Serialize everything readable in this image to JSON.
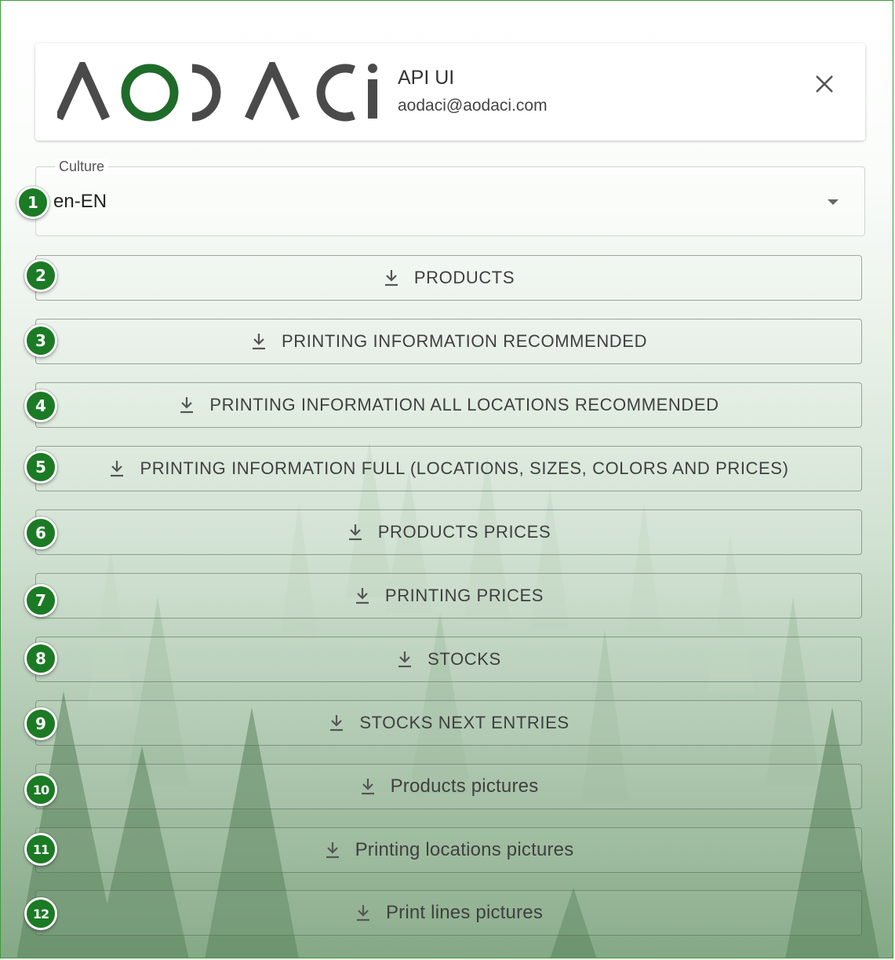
{
  "header": {
    "logo_text": "AODACi",
    "app_name": "API UI",
    "email": "aodaci@aodaci.com",
    "close_icon": "close-icon"
  },
  "culture_select": {
    "label": "Culture",
    "value": "en-EN"
  },
  "download_icon": "download-icon",
  "buttons": [
    {
      "badge": "1",
      "label": ""
    },
    {
      "badge": "2",
      "label": "PRODUCTS"
    },
    {
      "badge": "3",
      "label": "PRINTING INFORMATION RECOMMENDED"
    },
    {
      "badge": "4",
      "label": "PRINTING INFORMATION ALL LOCATIONS RECOMMENDED"
    },
    {
      "badge": "5",
      "label": "PRINTING INFORMATION FULL (LOCATIONS, SIZES, COLORS AND PRICES)"
    },
    {
      "badge": "6",
      "label": "PRODUCTS PRICES"
    },
    {
      "badge": "7",
      "label": "PRINTING PRICES"
    },
    {
      "badge": "8",
      "label": "STOCKS"
    },
    {
      "badge": "9",
      "label": "STOCKS NEXT ENTRIES"
    },
    {
      "badge": "10",
      "label": "Products pictures"
    },
    {
      "badge": "11",
      "label": "Printing locations pictures"
    },
    {
      "badge": "12",
      "label": "Print lines pictures"
    }
  ],
  "colors": {
    "badge_green": "#1b7a24",
    "logo_gray": "#4a4a4a",
    "logo_green": "#1f6b2a"
  }
}
